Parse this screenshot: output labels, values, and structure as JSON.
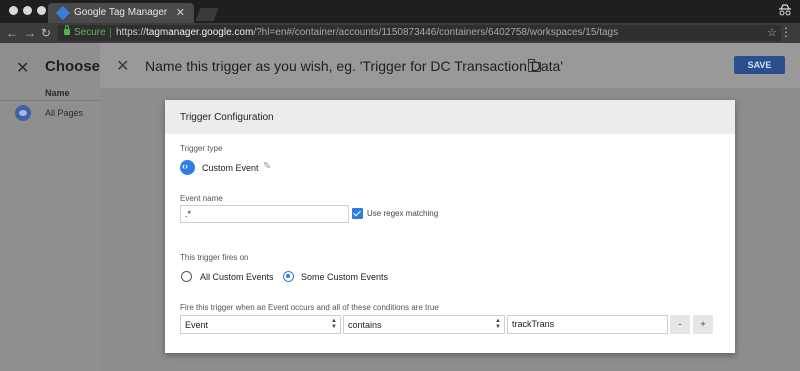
{
  "browser": {
    "tab_title": "Google Tag Manager",
    "tab_close": "✕",
    "secure_label": "Secure",
    "url_scheme": "https://",
    "url_host": "tagmanager.google.com",
    "url_rest": "/?hl=en#/container/accounts/1150873446/containers/6402758/workspaces/15/tags"
  },
  "left_panel": {
    "title": "Choose a",
    "column_header": "Name",
    "item_label": "All Pages"
  },
  "header": {
    "trigger_name": "Name this trigger as you wish, eg. 'Trigger for DC Transaction Data'",
    "save_label": "SAVE"
  },
  "card": {
    "title": "Trigger Configuration",
    "trigger_type_label": "Trigger type",
    "trigger_type_value": "Custom Event",
    "event_name_label": "Event name",
    "event_name_value": ".*",
    "regex_label": "Use regex matching",
    "regex_checked": true,
    "fires_on_label": "This trigger fires on",
    "options": [
      "All Custom Events",
      "Some Custom Events"
    ],
    "selected_option": "Some Custom Events",
    "condition_label": "Fire this trigger when an Event occurs and all of these conditions are true",
    "condition": {
      "variable": "Event",
      "operator": "contains",
      "value": "trackTrans"
    },
    "remove_label": "-",
    "add_label": "+"
  },
  "colors": {
    "accent": "#2f7de1",
    "save_button": "#2a4f8e",
    "secure_green": "#56b051"
  }
}
